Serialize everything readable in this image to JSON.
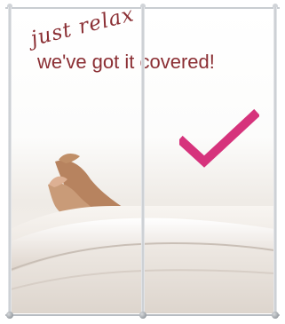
{
  "tagline": {
    "script": "just relax",
    "main": "we've got it covered!"
  },
  "icons": {
    "check": "check-mark-icon"
  },
  "colors": {
    "tagline": "#8b2f34",
    "check": "#d6337c",
    "frame": "#c9cdd2"
  }
}
